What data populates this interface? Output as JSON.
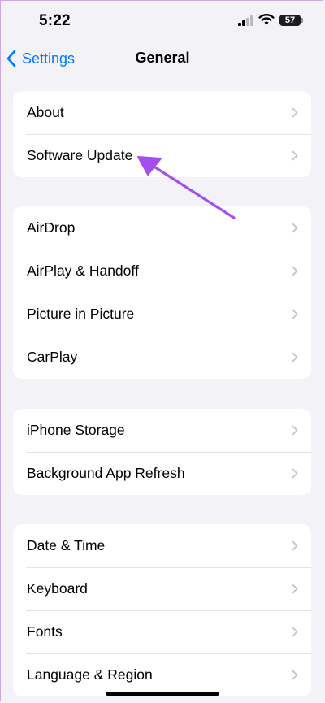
{
  "status_bar": {
    "time": "5:22",
    "battery": "57"
  },
  "nav": {
    "back_label": "Settings",
    "title": "General"
  },
  "groups": [
    {
      "items": [
        {
          "label": "About"
        },
        {
          "label": "Software Update"
        }
      ]
    },
    {
      "items": [
        {
          "label": "AirDrop"
        },
        {
          "label": "AirPlay & Handoff"
        },
        {
          "label": "Picture in Picture"
        },
        {
          "label": "CarPlay"
        }
      ]
    },
    {
      "items": [
        {
          "label": "iPhone Storage"
        },
        {
          "label": "Background App Refresh"
        }
      ]
    },
    {
      "items": [
        {
          "label": "Date & Time"
        },
        {
          "label": "Keyboard"
        },
        {
          "label": "Fonts"
        },
        {
          "label": "Language & Region"
        }
      ]
    }
  ],
  "colors": {
    "accent": "#007aff",
    "annotation": "#a44ef0",
    "background": "#f2f2f7"
  }
}
